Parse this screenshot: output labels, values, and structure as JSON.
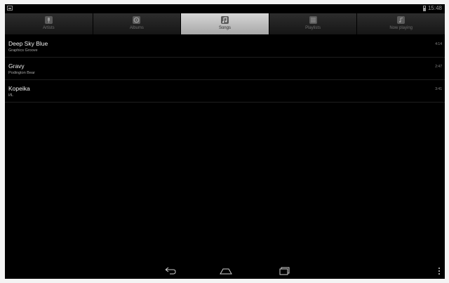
{
  "status_bar": {
    "time": "15:48",
    "notification_icon": "image-notification-icon",
    "battery_icon": "battery-icon"
  },
  "tabs": [
    {
      "label": "Artists",
      "icon": "microphone-icon",
      "active": false
    },
    {
      "label": "Albums",
      "icon": "album-icon",
      "active": false
    },
    {
      "label": "Songs",
      "icon": "music-note-icon",
      "active": true
    },
    {
      "label": "Playlists",
      "icon": "playlist-icon",
      "active": false
    },
    {
      "label": "Now playing",
      "icon": "now-playing-icon",
      "active": false
    }
  ],
  "songs": [
    {
      "title": "Deep Sky Blue",
      "artist": "Graphics Groove",
      "duration": "4:14"
    },
    {
      "title": "Gravy",
      "artist": "Podington Bear",
      "duration": "2:47"
    },
    {
      "title": "Kopeika",
      "artist": "ИL",
      "duration": "3:41"
    }
  ],
  "navbar": {
    "back_icon": "back-icon",
    "home_icon": "home-icon",
    "recents_icon": "recent-apps-icon",
    "menu_icon": "overflow-menu-icon"
  },
  "colors": {
    "background": "#000000",
    "active_tab": "#c4c4c4",
    "inactive_tab": "#222222",
    "title_text": "#f0f0f0",
    "subtitle_text": "#a8a8a8"
  }
}
